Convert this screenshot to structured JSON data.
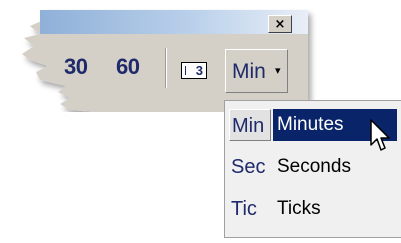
{
  "window": {
    "close_glyph": "×"
  },
  "toolbar": {
    "partial_number": "30",
    "number_60": "60",
    "frame_count": "3",
    "unit_button_label": "Min",
    "dropdown_arrow": "▾"
  },
  "menu": {
    "items": [
      {
        "short": "Min",
        "full": "Minutes",
        "selected": true
      },
      {
        "short": "Sec",
        "full": "Seconds",
        "selected": false
      },
      {
        "short": "Tic",
        "full": "Ticks",
        "selected": false
      }
    ]
  },
  "icons": {
    "cursor": "arrow-pointer-icon"
  },
  "colors": {
    "selection": "#0a246a",
    "menu_bg": "#f0f0f0",
    "button_face": "#d4d0c8",
    "text_blue": "#1f2a6b"
  }
}
